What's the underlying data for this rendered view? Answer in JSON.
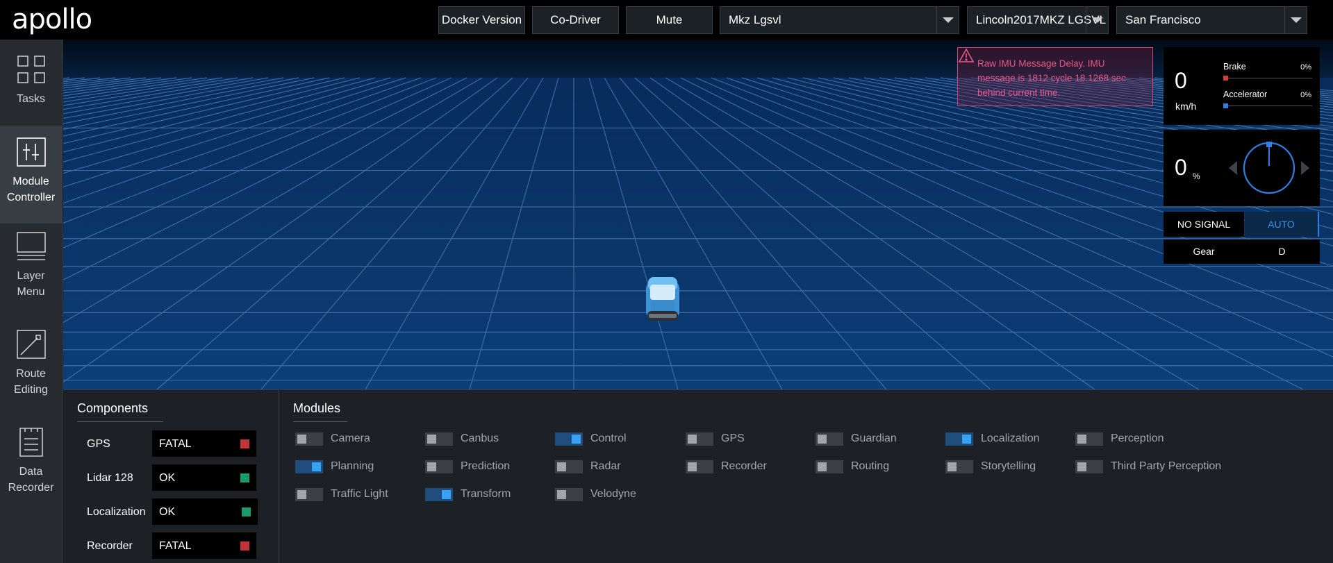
{
  "header": {
    "logo": "apollo",
    "buttons": [
      "Docker Version",
      "Co-Driver",
      "Mute"
    ],
    "selects": [
      {
        "value": "Mkz Lgsvl"
      },
      {
        "value": "Lincoln2017MKZ LGSVL"
      },
      {
        "value": "San Francisco"
      }
    ]
  },
  "sidebar": {
    "items": [
      {
        "label": "Tasks",
        "icon": "tasks-grid-icon",
        "active": false
      },
      {
        "label": "Module Controller",
        "icon": "module-controller-icon",
        "active": true
      },
      {
        "label": "Layer Menu",
        "icon": "layer-menu-icon",
        "active": false
      },
      {
        "label": "Route Editing",
        "icon": "route-editing-icon",
        "active": false
      },
      {
        "label": "Data Recorder",
        "icon": "data-recorder-icon",
        "active": false
      }
    ]
  },
  "alert": {
    "text": "Raw IMU Message Delay. IMU message is 1812 cycle 18.1268 sec behind current time.",
    "color": "#e75a8a",
    "icon": "warning-icon"
  },
  "dashboard": {
    "speed": "0",
    "speed_unit": "km/h",
    "brake_label": "Brake",
    "brake_pct": "0%",
    "accel_label": "Accelerator",
    "accel_pct": "0%",
    "steering": "0",
    "steering_unit": "%",
    "signal": "NO SIGNAL",
    "mode": "AUTO",
    "gear_label": "Gear",
    "gear": "D"
  },
  "components": {
    "title": "Components",
    "rows": [
      {
        "name": "GPS",
        "status": "FATAL",
        "color": "#c0343a"
      },
      {
        "name": "Lidar 128",
        "status": "OK",
        "color": "#1b9a6a"
      },
      {
        "name": "Localization",
        "status": "OK",
        "color": "#1b9a6a"
      },
      {
        "name": "Recorder",
        "status": "FATAL",
        "color": "#c0343a"
      }
    ]
  },
  "modules": {
    "title": "Modules",
    "items": [
      {
        "label": "Camera",
        "on": false
      },
      {
        "label": "Canbus",
        "on": false
      },
      {
        "label": "Control",
        "on": true
      },
      {
        "label": "GPS",
        "on": false
      },
      {
        "label": "Guardian",
        "on": false
      },
      {
        "label": "Localization",
        "on": true
      },
      {
        "label": "Perception",
        "on": false
      },
      {
        "label": "Planning",
        "on": true
      },
      {
        "label": "Prediction",
        "on": false
      },
      {
        "label": "Radar",
        "on": false
      },
      {
        "label": "Recorder",
        "on": false
      },
      {
        "label": "Routing",
        "on": false
      },
      {
        "label": "Storytelling",
        "on": false
      },
      {
        "label": "Third Party Perception",
        "on": false
      },
      {
        "label": "Traffic Light",
        "on": false
      },
      {
        "label": "Transform",
        "on": true
      },
      {
        "label": "Velodyne",
        "on": false
      }
    ]
  }
}
